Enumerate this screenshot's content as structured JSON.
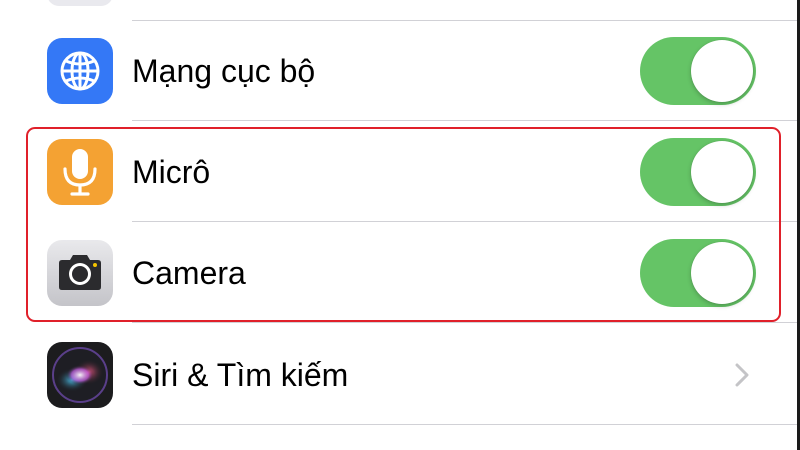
{
  "settings": {
    "rows": [
      {
        "label": "Mạng cục bộ",
        "icon": "globe-icon",
        "icon_color": "#3478f6",
        "control": "toggle",
        "enabled": true
      },
      {
        "label": "Micrô",
        "icon": "microphone-icon",
        "icon_color": "#f4a233",
        "control": "toggle",
        "enabled": true
      },
      {
        "label": "Camera",
        "icon": "camera-icon",
        "icon_color": "#c8c8cd",
        "control": "toggle",
        "enabled": true
      },
      {
        "label": "Siri & Tìm kiếm",
        "icon": "siri-icon",
        "icon_color": "#1c1c1e",
        "control": "chevron"
      }
    ]
  },
  "colors": {
    "toggle_on": "#65c466",
    "separator": "#d1d1d6",
    "highlight": "#e0202a",
    "chevron": "#c4c4c7"
  }
}
